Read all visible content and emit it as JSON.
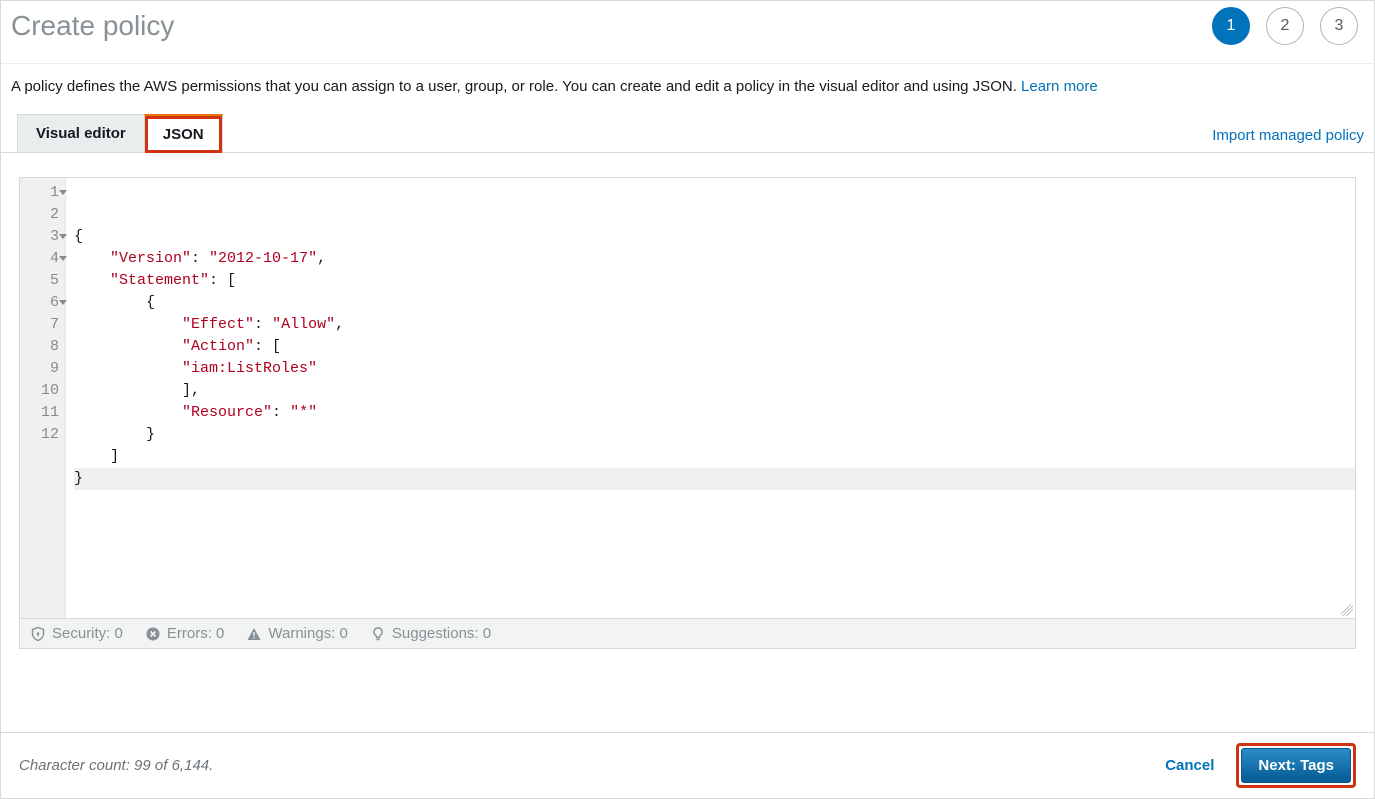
{
  "header": {
    "title": "Create policy",
    "steps": [
      "1",
      "2",
      "3"
    ],
    "active_step": 0
  },
  "description": {
    "text": "A policy defines the AWS permissions that you can assign to a user, group, or role. You can create and edit a policy in the visual editor and using JSON. ",
    "link": "Learn more"
  },
  "tabs": {
    "visual": "Visual editor",
    "json": "JSON",
    "import": "Import managed policy"
  },
  "editor": {
    "line_numbers": [
      "1",
      "2",
      "3",
      "4",
      "5",
      "6",
      "7",
      "8",
      "9",
      "10",
      "11",
      "12"
    ],
    "fold_lines": [
      1,
      3,
      4,
      6
    ],
    "cursor_line": 12,
    "lines": [
      [
        {
          "t": "{",
          "c": ""
        }
      ],
      [
        {
          "t": "    ",
          "c": ""
        },
        {
          "t": "\"Version\"",
          "c": "str"
        },
        {
          "t": ": ",
          "c": ""
        },
        {
          "t": "\"2012-10-17\"",
          "c": "str"
        },
        {
          "t": ",",
          "c": ""
        }
      ],
      [
        {
          "t": "    ",
          "c": ""
        },
        {
          "t": "\"Statement\"",
          "c": "str"
        },
        {
          "t": ": [",
          "c": ""
        }
      ],
      [
        {
          "t": "        {",
          "c": ""
        }
      ],
      [
        {
          "t": "            ",
          "c": ""
        },
        {
          "t": "\"Effect\"",
          "c": "str"
        },
        {
          "t": ": ",
          "c": ""
        },
        {
          "t": "\"Allow\"",
          "c": "str"
        },
        {
          "t": ",",
          "c": ""
        }
      ],
      [
        {
          "t": "            ",
          "c": ""
        },
        {
          "t": "\"Action\"",
          "c": "str"
        },
        {
          "t": ": [",
          "c": ""
        }
      ],
      [
        {
          "t": "            ",
          "c": ""
        },
        {
          "t": "\"iam:ListRoles\"",
          "c": "str"
        }
      ],
      [
        {
          "t": "            ],",
          "c": ""
        }
      ],
      [
        {
          "t": "            ",
          "c": ""
        },
        {
          "t": "\"Resource\"",
          "c": "str"
        },
        {
          "t": ": ",
          "c": ""
        },
        {
          "t": "\"*\"",
          "c": "str"
        }
      ],
      [
        {
          "t": "        }",
          "c": ""
        }
      ],
      [
        {
          "t": "    ]",
          "c": ""
        }
      ],
      [
        {
          "t": "}",
          "c": ""
        }
      ]
    ]
  },
  "status": {
    "security": "Security: 0",
    "errors": "Errors: 0",
    "warnings": "Warnings: 0",
    "suggestions": "Suggestions: 0"
  },
  "footer": {
    "char_count": "Character count: 99 of 6,144.",
    "cancel": "Cancel",
    "next": "Next: Tags"
  }
}
